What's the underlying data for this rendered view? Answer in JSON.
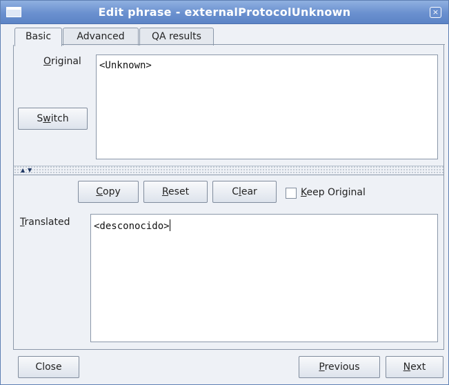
{
  "window": {
    "title": "Edit phrase - externalProtocolUnknown",
    "close_glyph": "×"
  },
  "tabs": [
    {
      "label": "Basic",
      "active": true
    },
    {
      "label": "Advanced",
      "active": false
    },
    {
      "label": "QA results",
      "active": false
    }
  ],
  "original": {
    "label_prefix": "",
    "label_mnemonic": "O",
    "label_rest": "riginal",
    "text": "<Unknown>"
  },
  "switch_button": {
    "pre": "S",
    "mnemonic": "w",
    "post": "itch"
  },
  "splitter": {
    "up_icon": "▲",
    "down_icon": "▼"
  },
  "actions": {
    "copy": {
      "mnemonic": "C",
      "rest": "opy"
    },
    "reset": {
      "mnemonic": "R",
      "rest": "eset"
    },
    "clear": {
      "pre": "C",
      "mnemonic": "l",
      "post": "ear"
    },
    "keep_original": {
      "mnemonic": "K",
      "rest": "eep Original",
      "checked": false
    }
  },
  "translated": {
    "label_mnemonic": "T",
    "label_rest": "ranslated",
    "text": "<desconocido>"
  },
  "footer": {
    "close": "Close",
    "previous": {
      "mnemonic": "P",
      "rest": "revious"
    },
    "next": {
      "mnemonic": "N",
      "rest": "ext"
    }
  },
  "colors": {
    "titlebar": "#6a90cf",
    "window_bg": "#eef1f6",
    "border": "#8a97a8"
  }
}
